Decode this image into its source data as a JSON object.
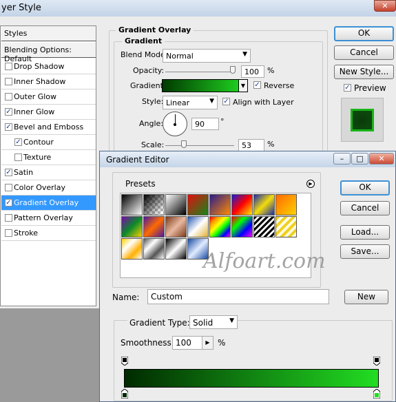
{
  "layer_style": {
    "title": "yer Style",
    "sidebar": [
      {
        "label": "Styles",
        "type": "header"
      },
      {
        "label": "Blending Options: Default",
        "type": "header"
      },
      {
        "label": "Drop Shadow",
        "checked": false
      },
      {
        "label": "Inner Shadow",
        "checked": false
      },
      {
        "label": "Outer Glow",
        "checked": false
      },
      {
        "label": "Inner Glow",
        "checked": true
      },
      {
        "label": "Bevel and Emboss",
        "checked": true
      },
      {
        "label": "Contour",
        "checked": true,
        "indent": true
      },
      {
        "label": "Texture",
        "checked": false,
        "indent": true
      },
      {
        "label": "Satin",
        "checked": true
      },
      {
        "label": "Color Overlay",
        "checked": false
      },
      {
        "label": "Gradient Overlay",
        "checked": true,
        "selected": true
      },
      {
        "label": "Pattern Overlay",
        "checked": false
      },
      {
        "label": "Stroke",
        "checked": false
      }
    ],
    "group_title": "Gradient Overlay",
    "subgroup_title": "Gradient",
    "blend_mode_label": "Blend Mode:",
    "blend_mode_value": "Normal",
    "opacity_label": "Opacity:",
    "opacity_value": "100",
    "opacity_unit": "%",
    "gradient_label": "Gradient:",
    "reverse_label": "Reverse",
    "style_label": "Style:",
    "style_value": "Linear",
    "align_label": "Align with Layer",
    "angle_label": "Angle:",
    "angle_value": "90",
    "angle_unit": "°",
    "scale_label": "Scale:",
    "scale_value": "53",
    "scale_unit": "%",
    "ok": "OK",
    "cancel": "Cancel",
    "new_style": "New Style...",
    "preview_label": "Preview"
  },
  "gradient_editor": {
    "title": "Gradient Editor",
    "presets_label": "Presets",
    "ok": "OK",
    "cancel": "Cancel",
    "load": "Load...",
    "save": "Save...",
    "watermark": "Alfoart.com",
    "name_label": "Name:",
    "name_value": "Custom",
    "new": "New",
    "gradient_type_label": "Gradient Type:",
    "gradient_type_value": "Solid",
    "smoothness_label": "Smoothness:",
    "smoothness_value": "100",
    "smoothness_unit": "%"
  },
  "colors": {
    "accent": "#3399ff",
    "gradient_start": "#002a00",
    "gradient_end": "#22dd22"
  }
}
